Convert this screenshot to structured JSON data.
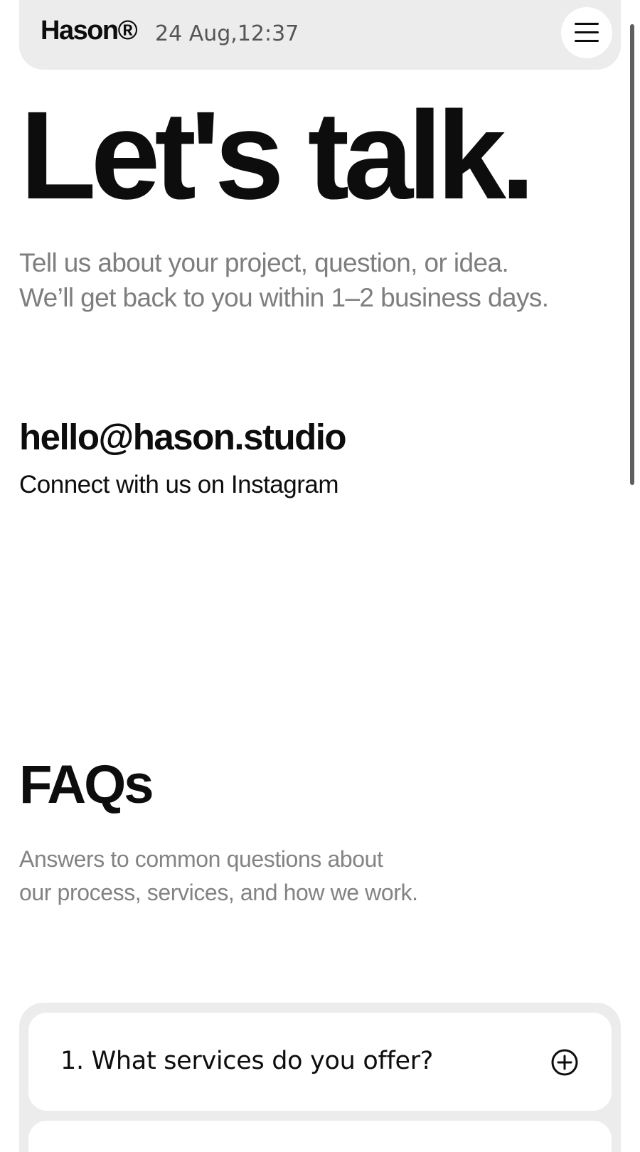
{
  "header": {
    "brand": "Hason®",
    "datetime": "24 Aug,12:37",
    "menu_icon": "hamburger-menu-icon"
  },
  "hero": {
    "title": "Let's talk.",
    "subtitle_line1": "Tell us about your project, question, or idea.",
    "subtitle_line2": "We’ll get back to you within 1–2 business days.",
    "email": "hello@hason.studio",
    "instagram_link": "Connect with us on Instagram"
  },
  "faq": {
    "title": "FAQs",
    "subtitle_line1": "Answers to common questions about",
    "subtitle_line2": "our process, services, and how we work.",
    "items": [
      {
        "question": "1. What services do you offer?",
        "icon": "plus-circle-icon"
      }
    ]
  },
  "colors": {
    "text": "#0d0d0d",
    "muted": "#7e7e7e",
    "panel": "#ececec",
    "background": "#ffffff"
  }
}
